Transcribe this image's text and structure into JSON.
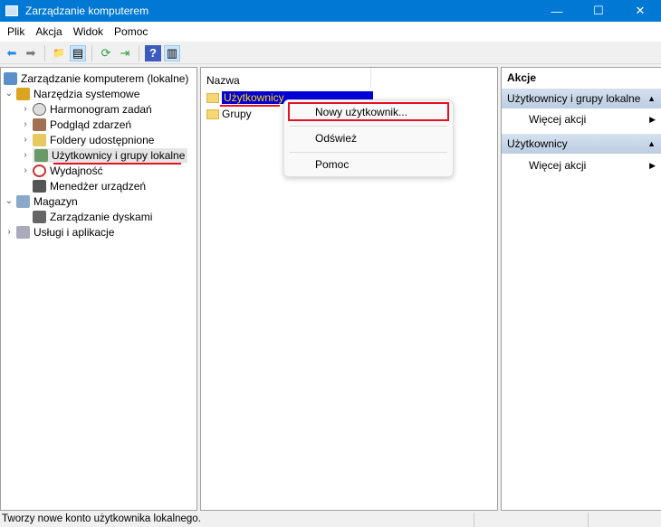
{
  "window": {
    "title": "Zarządzanie komputerem",
    "minimize": "—",
    "maximize": "☐",
    "close": "✕"
  },
  "menu": [
    "Plik",
    "Akcja",
    "Widok",
    "Pomoc"
  ],
  "toolbar": [
    {
      "icon": "back-arrow-icon",
      "glyph": "⬅"
    },
    {
      "icon": "forward-arrow-icon",
      "glyph": "➡"
    },
    {
      "icon": "up-folder-icon",
      "glyph": "📁"
    },
    {
      "icon": "show-hide-tree-icon",
      "glyph": "▤"
    },
    {
      "icon": "refresh-icon",
      "glyph": "⟳"
    },
    {
      "icon": "export-list-icon",
      "glyph": "⇥"
    },
    {
      "icon": "help-icon",
      "glyph": "?"
    },
    {
      "icon": "show-hide-action-pane-icon",
      "glyph": "▥"
    }
  ],
  "tree": [
    {
      "label": "Zarządzanie komputerem (lokalne)",
      "level": 0,
      "chev": ""
    },
    {
      "label": "Narzędzia systemowe",
      "level": 1,
      "chev": "⌄"
    },
    {
      "label": "Harmonogram zadań",
      "level": 2,
      "chev": "›"
    },
    {
      "label": "Podgląd zdarzeń",
      "level": 2,
      "chev": "›"
    },
    {
      "label": "Foldery udostępnione",
      "level": 2,
      "chev": "›"
    },
    {
      "label": "Użytkownicy i grupy lokalne",
      "level": 2,
      "chev": "›"
    },
    {
      "label": "Wydajność",
      "level": 2,
      "chev": "›"
    },
    {
      "label": "Menedżer urządzeń",
      "level": 2,
      "chev": ""
    },
    {
      "label": "Magazyn",
      "level": 1,
      "chev": "⌄"
    },
    {
      "label": "Zarządzanie dyskami",
      "level": 2,
      "chev": ""
    },
    {
      "label": "Usługi i aplikacje",
      "level": 1,
      "chev": "›"
    }
  ],
  "center": {
    "column": "Nazwa",
    "items": [
      "Użytkownicy",
      "Grupy"
    ]
  },
  "context_menu": [
    "Nowy użytkownik...",
    "Odśwież",
    "Pomoc"
  ],
  "actions": {
    "title": "Akcje",
    "groups": [
      {
        "label": "Użytkownicy i grupy lokalne",
        "more": "Więcej akcji"
      },
      {
        "label": "Użytkownicy",
        "more": "Więcej akcji"
      }
    ],
    "collapse": "▲",
    "expand": "▶"
  },
  "status": "Tworzy nowe konto użytkownika lokalnego."
}
